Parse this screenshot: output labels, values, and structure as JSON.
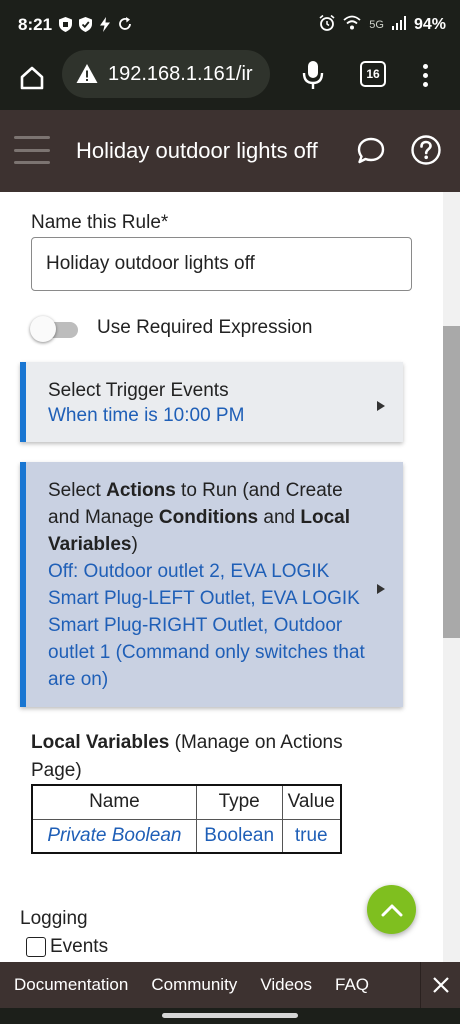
{
  "status_bar": {
    "time": "8:21",
    "network": "5G",
    "battery": "94%"
  },
  "browser": {
    "url": "192.168.1.161/ir",
    "tab_count": "16"
  },
  "app_bar": {
    "title": "Holiday outdoor lights off"
  },
  "form": {
    "name_label": "Name this Rule*",
    "name_value": "Holiday outdoor lights off",
    "required_expression_label": "Use Required Expression",
    "required_expression_enabled": false
  },
  "trigger_card": {
    "title": "Select Trigger Events",
    "summary": "When time is 10:00 PM"
  },
  "actions_card": {
    "title_part1": "Select ",
    "title_bold1": "Actions",
    "title_part2": " to Run (and Create and Manage ",
    "title_bold2": "Conditions",
    "title_part3": " and ",
    "title_bold3": "Local Variables",
    "title_part4": ")",
    "summary": "Off: Outdoor outlet 2, EVA LOGIK Smart Plug-LEFT Outlet, EVA LOGIK Smart Plug-RIGHT Outlet, Outdoor outlet 1 (Command only switches that are on)"
  },
  "local_variables": {
    "title": "Local Variables",
    "subtitle": " (Manage on Actions Page)",
    "headers": [
      "Name",
      "Type",
      "Value"
    ],
    "rows": [
      {
        "name": "Private Boolean",
        "type": "Boolean",
        "value": "true"
      }
    ]
  },
  "logging": {
    "label": "Logging",
    "events_label": "Events",
    "events_checked": false
  },
  "footer": {
    "links": [
      "Documentation",
      "Community",
      "Videos",
      "FAQ"
    ]
  },
  "colors": {
    "accent": "#1976d2",
    "header_bg": "#3d3230",
    "fab": "#7fbf1f",
    "link_text": "#1f5fb7"
  }
}
